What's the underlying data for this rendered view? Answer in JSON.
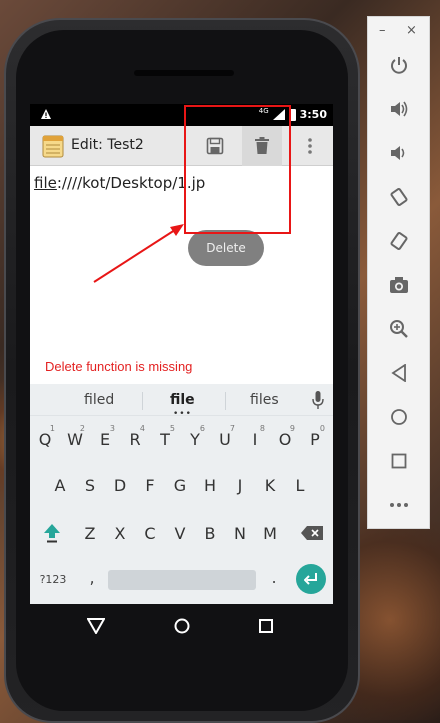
{
  "status_bar": {
    "time": "3:50",
    "network": "4G"
  },
  "action_bar": {
    "title": "Edit: Test2",
    "save_icon": "save-icon",
    "delete_icon": "delete-icon",
    "overflow_icon": "overflow-menu-icon"
  },
  "editor": {
    "text_underlined": "file",
    "text_rest": ":////kot/Desktop/1.jp"
  },
  "toast": {
    "label": "Delete"
  },
  "annotation": {
    "text": "Delete function is missing",
    "color": "#e32222"
  },
  "keyboard": {
    "suggestions": [
      "filed",
      "file",
      "files"
    ],
    "suggestion_dots": "•••",
    "row1": [
      {
        "k": "Q",
        "n": "1"
      },
      {
        "k": "W",
        "n": "2"
      },
      {
        "k": "E",
        "n": "3"
      },
      {
        "k": "R",
        "n": "4"
      },
      {
        "k": "T",
        "n": "5"
      },
      {
        "k": "Y",
        "n": "6"
      },
      {
        "k": "U",
        "n": "7"
      },
      {
        "k": "I",
        "n": "8"
      },
      {
        "k": "O",
        "n": "9"
      },
      {
        "k": "P",
        "n": "0"
      }
    ],
    "row2": [
      "A",
      "S",
      "D",
      "F",
      "G",
      "H",
      "J",
      "K",
      "L"
    ],
    "row3": [
      "Z",
      "X",
      "C",
      "V",
      "B",
      "N",
      "M"
    ],
    "symbols_label": "?123",
    "comma": ",",
    "period": ".",
    "accent_color": "#26a69a"
  },
  "nav": {
    "back": "back-icon",
    "home": "home-icon",
    "recent": "recent-apps-icon"
  },
  "side_panel": {
    "minimize": "–",
    "close": "×",
    "buttons": [
      "power-icon",
      "volume-up-icon",
      "volume-down-icon",
      "rotate-left-icon",
      "rotate-right-icon",
      "camera-icon",
      "zoom-icon",
      "back-icon",
      "home-icon",
      "overview-icon",
      "more-icon"
    ]
  },
  "highlight_color": "#e81616"
}
